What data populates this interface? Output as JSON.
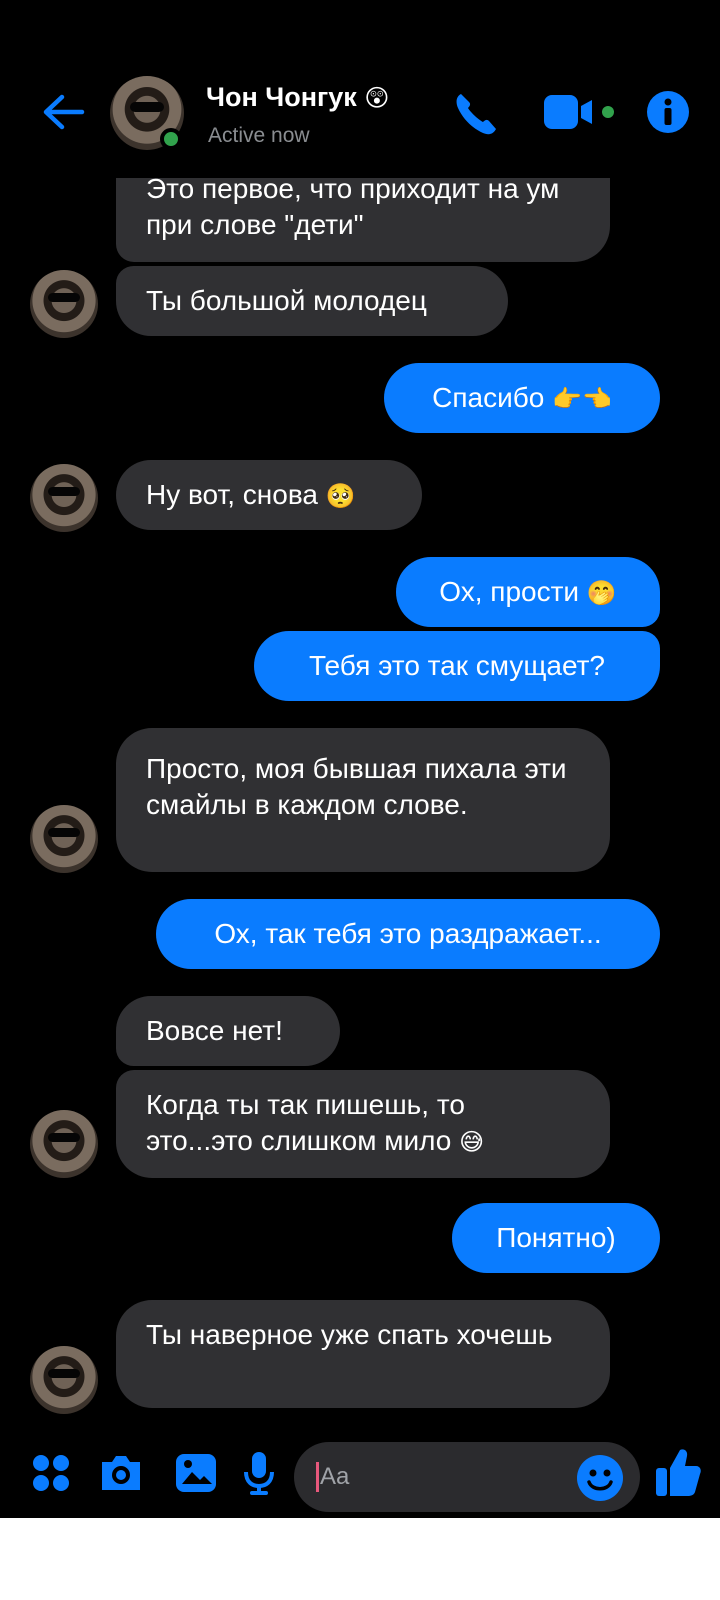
{
  "header": {
    "contact_name": "Чон Чонгук",
    "contact_emoji": "😲",
    "status": "Active now"
  },
  "messages": [
    {
      "from": "contact",
      "text": "Это первое, что приходит на ум при слове \"дети\""
    },
    {
      "from": "contact",
      "text": "Ты большой молодец"
    },
    {
      "from": "me",
      "text": "Спасибо",
      "emoji": "👉👈"
    },
    {
      "from": "contact",
      "text": "Ну вот, снова",
      "emoji": "🥺"
    },
    {
      "from": "me",
      "text": "Ох, прости",
      "emoji": "🤭"
    },
    {
      "from": "me",
      "text": "Тебя это так смущает?"
    },
    {
      "from": "contact",
      "text": "Просто, моя бывшая пихала эти смайлы в каждом слове."
    },
    {
      "from": "me",
      "text": "Ох, так тебя это раздражает..."
    },
    {
      "from": "contact",
      "text": "Вовсе нет!"
    },
    {
      "from": "contact",
      "text": "Когда ты так пишешь, то это...это слишком мило",
      "emoji": "😅"
    },
    {
      "from": "me",
      "text": "Понятно)"
    },
    {
      "from": "contact",
      "text": "Ты наверное уже спать хочешь"
    }
  ],
  "composer": {
    "placeholder": "Aa"
  },
  "colors": {
    "accent": "#0a7cff",
    "incoming_bubble": "#303033",
    "online": "#31a24c",
    "background": "#000000"
  },
  "icons": [
    "back-arrow-icon",
    "phone-icon",
    "video-camera-icon",
    "info-icon",
    "apps-grid-icon",
    "camera-icon",
    "gallery-icon",
    "microphone-icon",
    "smiley-icon",
    "thumbs-up-icon"
  ]
}
